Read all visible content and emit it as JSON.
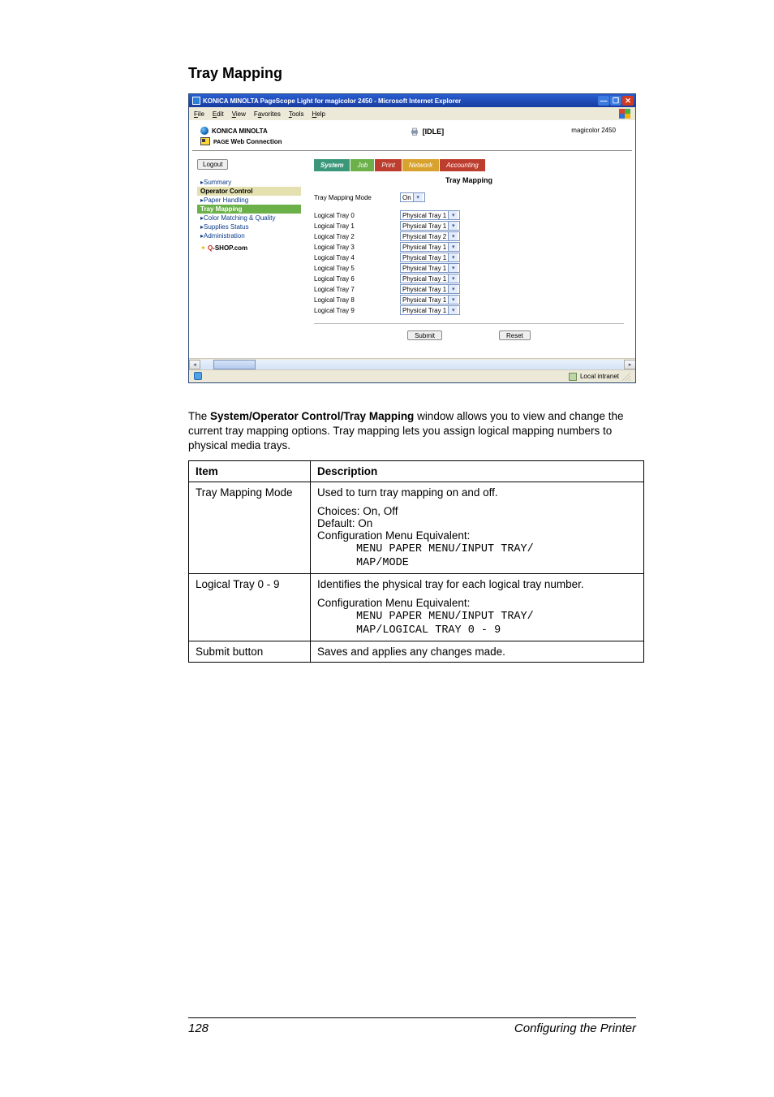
{
  "section_title": "Tray Mapping",
  "browser": {
    "title": "KONICA MINOLTA PageScope Light for magicolor 2450 - Microsoft Internet Explorer",
    "close_glyph": "✕",
    "max_glyph": "❐",
    "min_glyph": "—",
    "menu": {
      "file": "File",
      "edit": "Edit",
      "view": "View",
      "favorites": "Favorites",
      "tools": "Tools",
      "help": "Help"
    }
  },
  "header": {
    "brand1": "KONICA MINOLTA",
    "brand2_a": "PAGE",
    "brand2_b": " Web Connection",
    "status": "[IDLE]",
    "model": "magicolor 2450"
  },
  "sidebar": {
    "logout": "Logout",
    "items": [
      {
        "label": "Summary",
        "type": "link"
      },
      {
        "label": "Operator Control",
        "type": "head"
      },
      {
        "label": "Paper Handling",
        "type": "link"
      },
      {
        "label": "Tray Mapping",
        "type": "active"
      },
      {
        "label": "Color Matching & Quality",
        "type": "link"
      },
      {
        "label": "Supplies Status",
        "type": "link"
      },
      {
        "label": "Administration",
        "type": "link"
      }
    ],
    "qshop_label": "Q-SHOP.com"
  },
  "tabs": [
    "System",
    "Job",
    "Print",
    "Network",
    "Accounting"
  ],
  "panel": {
    "title": "Tray Mapping",
    "mode_label": "Tray Mapping Mode",
    "mode_value": "On",
    "rows": [
      {
        "label": "Logical Tray 0",
        "value": "Physical Tray 1"
      },
      {
        "label": "Logical Tray 1",
        "value": "Physical Tray 1"
      },
      {
        "label": "Logical Tray 2",
        "value": "Physical Tray 2"
      },
      {
        "label": "Logical Tray 3",
        "value": "Physical Tray 1"
      },
      {
        "label": "Logical Tray 4",
        "value": "Physical Tray 1"
      },
      {
        "label": "Logical Tray 5",
        "value": "Physical Tray 1"
      },
      {
        "label": "Logical Tray 6",
        "value": "Physical Tray 1"
      },
      {
        "label": "Logical Tray 7",
        "value": "Physical Tray 1"
      },
      {
        "label": "Logical Tray 8",
        "value": "Physical Tray 1"
      },
      {
        "label": "Logical Tray 9",
        "value": "Physical Tray 1"
      }
    ],
    "submit": "Submit",
    "reset": "Reset"
  },
  "statusbar": {
    "intranet": "Local intranet"
  },
  "prose": {
    "p1_a": "The ",
    "p1_b": "System/Operator Control/Tray Mapping",
    "p1_c": " window allows you to view and change the current tray mapping options. Tray mapping lets you assign logical mapping numbers to physical media trays."
  },
  "table": {
    "headers": [
      "Item",
      "Description"
    ],
    "rows": [
      {
        "item": "Tray Mapping Mode",
        "lines": [
          "Used to turn tray mapping on and off.",
          "Choices: On, Off",
          "Default:  On",
          "Configuration Menu Equivalent:"
        ],
        "mono": "MENU PAPER MENU/INPUT TRAY/\nMAP/MODE"
      },
      {
        "item": "Logical Tray 0 - 9",
        "lines": [
          "Identifies the physical tray for each logical tray number.",
          "Configuration Menu Equivalent:"
        ],
        "mono": "MENU PAPER MENU/INPUT TRAY/\nMAP/LOGICAL TRAY 0 - 9"
      },
      {
        "item": "Submit button",
        "lines": [
          "Saves and applies any changes made."
        ],
        "mono": ""
      }
    ]
  },
  "footer": {
    "page": "128",
    "title": "Configuring the Printer"
  }
}
